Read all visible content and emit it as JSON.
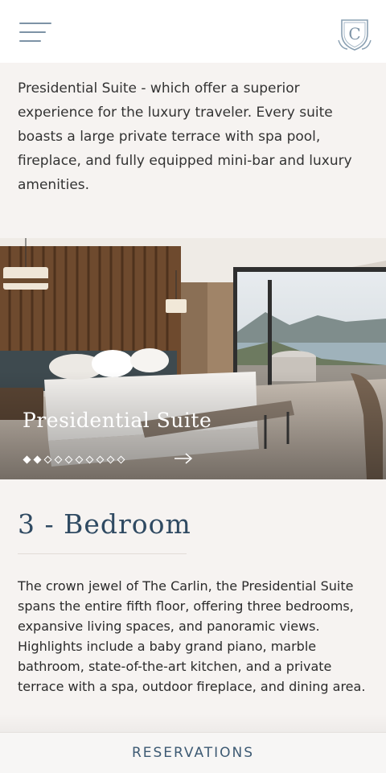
{
  "header": {
    "menu_icon": "hamburger-menu-icon",
    "logo_icon": "crest-logo-icon",
    "logo_letter": "C"
  },
  "intro": {
    "text": "Presidential Suite - which offer a superior experience for the luxury traveler. Every suite boasts a large private terrace with spa pool, fireplace, and fully equipped mini-bar and luxury amenities."
  },
  "carousel": {
    "title": "Presidential Suite",
    "slide_count": 10,
    "active_slides": [
      0,
      1
    ],
    "next_icon": "arrow-right-icon"
  },
  "section": {
    "title": "3 - Bedroom",
    "description": "The crown jewel of The Carlin, the Presidential Suite spans the entire fifth floor, offering three bedrooms, expansive living spaces, and panoramic views. Highlights include a baby grand piano, marble bathroom, state-of-the-art kitchen, and a private terrace with a spa, outdoor fireplace, and dining area."
  },
  "footer": {
    "reservations_label": "RESERVATIONS"
  },
  "colors": {
    "accent": "#2f4a62",
    "icon": "#7d93a6",
    "background": "#f6f3f1"
  }
}
